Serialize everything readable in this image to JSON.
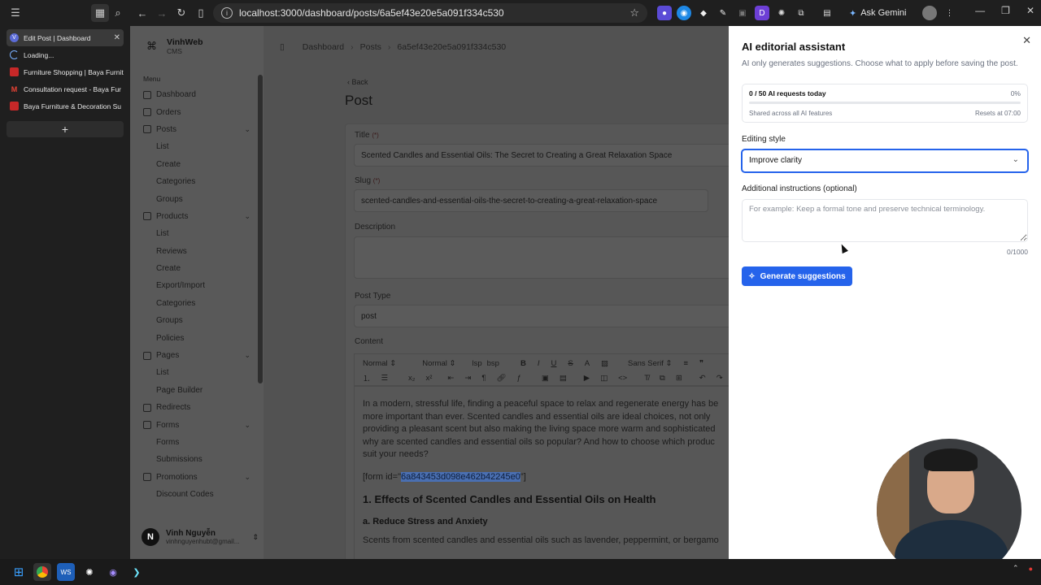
{
  "browser": {
    "url": "localhost:3000/dashboard/posts/6a5ef43e20e5a091f334c530",
    "ask_gemini": "Ask Gemini",
    "tabs": [
      {
        "title": "Edit Post | Dashboard",
        "active": true
      },
      {
        "title": "Loading...",
        "active": false
      },
      {
        "title": "Furniture Shopping | Baya Furnit",
        "active": false
      },
      {
        "title": "Consultation request - Baya Fur",
        "active": false
      },
      {
        "title": "Baya Furniture & Decoration Su",
        "active": false
      }
    ],
    "new_tab": "+"
  },
  "sidebar": {
    "brand_name": "VinhWeb",
    "brand_sub": "CMS",
    "menu_label": "Menu",
    "items": [
      {
        "label": "Dashboard",
        "type": "top"
      },
      {
        "label": "Orders",
        "type": "top"
      },
      {
        "label": "Posts",
        "type": "group"
      },
      {
        "label": "List",
        "type": "sub"
      },
      {
        "label": "Create",
        "type": "sub"
      },
      {
        "label": "Categories",
        "type": "sub"
      },
      {
        "label": "Groups",
        "type": "sub"
      },
      {
        "label": "Products",
        "type": "group"
      },
      {
        "label": "List",
        "type": "sub"
      },
      {
        "label": "Reviews",
        "type": "sub"
      },
      {
        "label": "Create",
        "type": "sub"
      },
      {
        "label": "Export/Import",
        "type": "sub"
      },
      {
        "label": "Categories",
        "type": "sub"
      },
      {
        "label": "Groups",
        "type": "sub"
      },
      {
        "label": "Policies",
        "type": "sub"
      },
      {
        "label": "Pages",
        "type": "group"
      },
      {
        "label": "List",
        "type": "sub"
      },
      {
        "label": "Page Builder",
        "type": "sub"
      },
      {
        "label": "Redirects",
        "type": "top"
      },
      {
        "label": "Forms",
        "type": "group"
      },
      {
        "label": "Forms",
        "type": "sub"
      },
      {
        "label": "Submissions",
        "type": "sub"
      },
      {
        "label": "Promotions",
        "type": "group"
      },
      {
        "label": "Discount Codes",
        "type": "sub"
      }
    ],
    "user_initial": "N",
    "user_name": "Vinh Nguyễn",
    "user_email": "vinhnguyenhubt@gmail..."
  },
  "main": {
    "breadcrumbs": [
      "Dashboard",
      "Posts",
      "6a5ef43e20e5a091f334c530"
    ],
    "back": "Back",
    "page_title": "Post",
    "title_label": "Title",
    "required_mark": "(*)",
    "title_value": "Scented Candles and Essential Oils: The Secret to Creating a Great Relaxation Space",
    "slug_label": "Slug",
    "slug_value": "scented-candles-and-essential-oils-the-secret-to-creating-a-great-relaxation-space",
    "description_label": "Description",
    "post_type_label": "Post Type",
    "post_type_value": "post",
    "content_label": "Content",
    "toolbar": {
      "heading1": "Normal",
      "heading2": "Normal",
      "lsp": "lsp",
      "bsp": "bsp",
      "font": "Sans Serif"
    },
    "editor": {
      "paragraph": "In a modern, stressful life, finding a peaceful space to relax and regenerate energy has be more important than ever. Scented candles and essential oils are ideal choices, not only providing a pleasant scent but also making the living space more warm and sophisticated why are scented candles and essential oils so popular? And how to choose which produc suit your needs?",
      "form_prefix": "[form id=\"",
      "form_id": "6a843453d098e462b42245e0",
      "form_suffix": "\"]",
      "h1": "1. Effects of Scented Candles and Essential Oils on Health",
      "h2": "a. Reduce Stress and Anxiety",
      "p2": "Scents from scented candles and essential oils such as lavender, peppermint, or bergamo"
    }
  },
  "ai_panel": {
    "title": "AI editorial assistant",
    "subtitle": "AI only generates suggestions. Choose what to apply before saving the post.",
    "quota_text": "0 / 50 AI requests today",
    "quota_percent": "0%",
    "quota_fraction": 0,
    "shared_text": "Shared across all AI features",
    "resets_text": "Resets at 07:00",
    "style_label": "Editing style",
    "style_value": "Improve clarity",
    "instructions_label": "Additional instructions (optional)",
    "instructions_placeholder": "For example: Keep a formal tone and preserve technical terminology.",
    "instructions_value": "",
    "char_count": "0/1000",
    "generate_label": "Generate suggestions"
  },
  "colors": {
    "accent": "#2563eb",
    "panel_bg": "#ffffff",
    "overlay_bg": "#525252",
    "highlight": "#4a6fb1"
  }
}
